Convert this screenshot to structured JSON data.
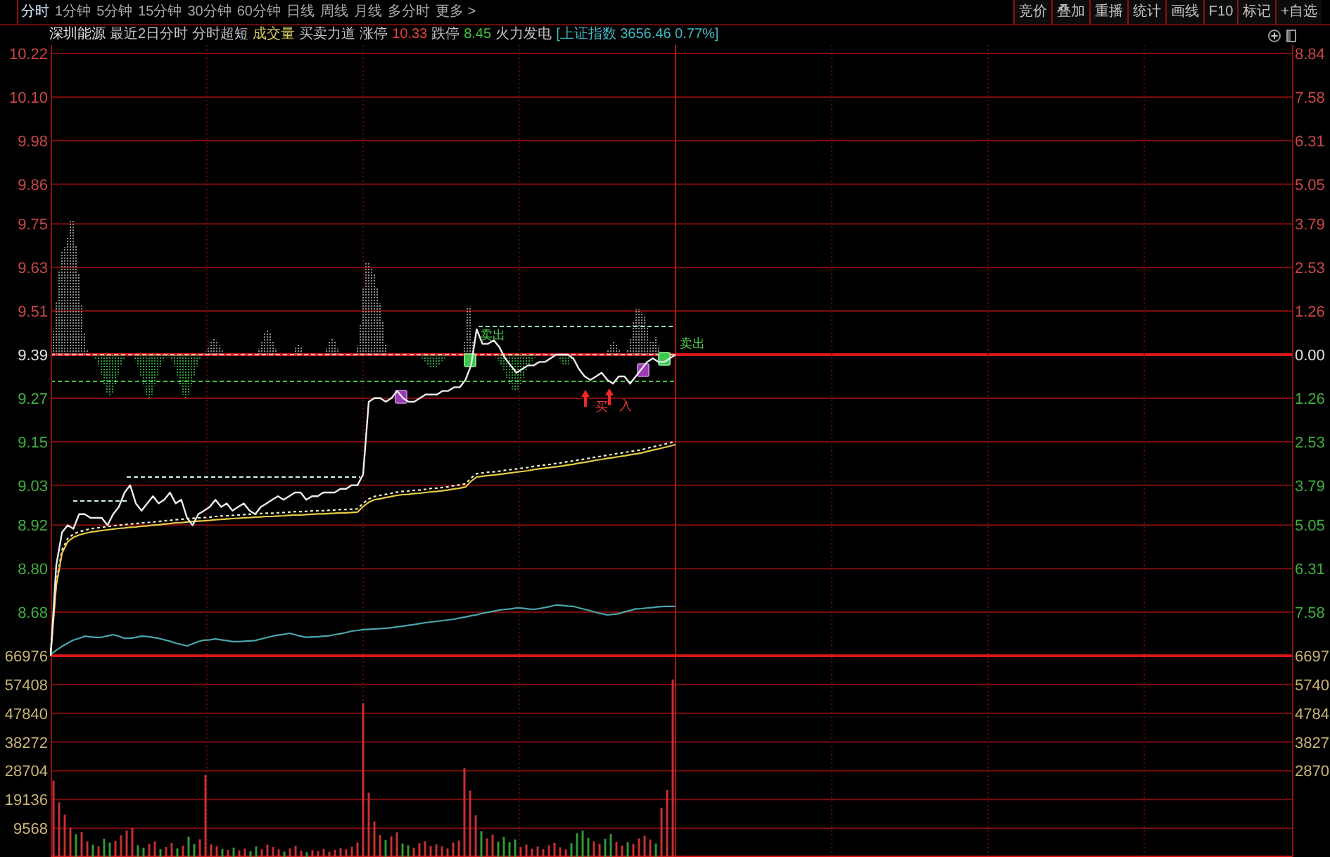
{
  "toolbar": {
    "tabs": [
      {
        "label": "分时",
        "selected": true
      },
      {
        "label": "1分钟",
        "selected": false
      },
      {
        "label": "5分钟",
        "selected": false
      },
      {
        "label": "15分钟",
        "selected": false
      },
      {
        "label": "30分钟",
        "selected": false
      },
      {
        "label": "60分钟",
        "selected": false
      },
      {
        "label": "日线",
        "selected": false
      },
      {
        "label": "周线",
        "selected": false
      },
      {
        "label": "月线",
        "selected": false
      },
      {
        "label": "多分时",
        "selected": false
      },
      {
        "label": "更多 >",
        "selected": false
      }
    ],
    "buttons": [
      "竞价",
      "叠加",
      "重播",
      "统计",
      "画线",
      "F10",
      "标记",
      "+自选"
    ]
  },
  "info_bar": [
    {
      "kind": "name",
      "text": "深圳能源"
    },
    {
      "kind": "option",
      "text": "最近2日分时"
    },
    {
      "kind": "option",
      "text": "分时超短"
    },
    {
      "kind": "volume",
      "text": "成交量"
    },
    {
      "kind": "option",
      "text": "买卖力道"
    },
    {
      "kind": "option",
      "text": "涨停"
    },
    {
      "kind": "up",
      "text": "10.33"
    },
    {
      "kind": "option",
      "text": "跌停"
    },
    {
      "kind": "down",
      "text": "8.45"
    },
    {
      "kind": "option",
      "text": "火力发电"
    },
    {
      "kind": "index",
      "text": "[上证指数 3656.46 0.77%]"
    }
  ],
  "chart": {
    "chart_data": {
      "type": "line",
      "ylim": [
        8.56,
        10.22
      ],
      "categories": [
        null,
        null,
        null,
        null,
        null,
        null,
        null,
        null,
        null,
        null,
        null,
        null,
        null,
        null,
        null,
        null,
        null,
        null,
        null,
        null,
        null,
        null,
        null,
        null,
        null,
        null,
        null,
        null,
        null,
        null,
        null,
        null,
        null,
        null,
        null,
        null,
        null,
        null,
        null,
        null,
        null,
        null,
        null,
        null,
        null,
        null,
        null,
        null,
        null,
        null,
        null,
        null,
        null,
        null,
        null,
        null,
        null,
        null,
        null,
        null,
        null,
        null,
        null,
        null,
        null,
        null,
        null,
        null,
        null,
        null,
        null,
        null,
        null,
        null,
        null,
        null,
        null,
        null,
        null,
        null,
        null,
        null,
        null,
        null,
        null,
        null,
        null,
        null,
        null,
        null,
        null,
        null,
        null,
        null,
        null,
        null,
        null,
        null,
        null,
        null,
        null,
        null,
        null,
        null,
        null,
        null,
        null,
        null,
        null,
        null,
        null
      ],
      "yticks": [
        {
          "value": 10.22,
          "label": "10.22"
        },
        {
          "value": 10.1,
          "label": "10.10"
        },
        {
          "value": 9.98,
          "label": "9.98"
        },
        {
          "value": 9.86,
          "label": "9.86"
        },
        {
          "value": 9.75,
          "label": "9.75"
        },
        {
          "value": 9.63,
          "label": "9.63"
        },
        {
          "value": 9.51,
          "label": "9.51"
        },
        {
          "value": 9.39,
          "label": "9.39"
        },
        {
          "value": 9.27,
          "label": "9.27"
        },
        {
          "value": 9.15,
          "label": "9.15"
        },
        {
          "value": 9.03,
          "label": "9.03"
        },
        {
          "value": 8.92,
          "label": "8.92"
        },
        {
          "value": 8.8,
          "label": "8.80"
        },
        {
          "value": 8.68,
          "label": "8.68"
        }
      ],
      "series": [
        {
          "color": "#ececec",
          "values": [
            8.56,
            8.81,
            8.9,
            8.92,
            8.91,
            8.95,
            8.95,
            8.94,
            8.94,
            8.94,
            8.92,
            8.95,
            8.97,
            9.01,
            9.03,
            8.98,
            8.96,
            8.98,
            9.0,
            8.98,
            8.99,
            9.01,
            8.98,
            8.99,
            8.94,
            8.92,
            8.95,
            8.96,
            8.97,
            8.99,
            8.97,
            8.98,
            8.96,
            8.97,
            8.98,
            8.96,
            8.95,
            8.97,
            8.98,
            8.99,
            9.0,
            8.99,
            9.0,
            9.01,
            9.01,
            8.99,
            9.0,
            9.0,
            9.01,
            9.01,
            9.01,
            9.02,
            9.02,
            9.03,
            9.03,
            9.06,
            9.26,
            9.27,
            9.27,
            9.26,
            9.27,
            9.29,
            9.27,
            9.26,
            9.26,
            9.27,
            9.28,
            9.28,
            9.28,
            9.29,
            9.29,
            9.3,
            9.3,
            9.32,
            9.36,
            9.46,
            9.42,
            9.42,
            9.43,
            9.41,
            9.38,
            9.36,
            9.34,
            9.35,
            9.36,
            9.36,
            9.37,
            9.37,
            9.38,
            9.39,
            9.39,
            9.39,
            9.38,
            9.35,
            9.33,
            9.32,
            9.33,
            9.34,
            9.32,
            9.31,
            9.33,
            9.33,
            9.31,
            9.33,
            9.35,
            9.37,
            9.38,
            9.37,
            9.37,
            9.38,
            9.39
          ]
        },
        {
          "color": "#e6cc44",
          "values": [
            8.564,
            8.754,
            8.843,
            8.874,
            8.886,
            8.893,
            8.897,
            8.901,
            8.903,
            8.905,
            8.907,
            8.909,
            8.911,
            8.912,
            8.914,
            8.915,
            8.917,
            8.918,
            8.92,
            8.921,
            8.923,
            8.924,
            8.926,
            8.927,
            8.929,
            8.93,
            8.931,
            8.932,
            8.933,
            8.935,
            8.936,
            8.937,
            8.938,
            8.939,
            8.94,
            8.941,
            8.942,
            8.943,
            8.944,
            8.944,
            8.945,
            8.946,
            8.947,
            8.948,
            8.948,
            8.949,
            8.95,
            8.951,
            8.951,
            8.952,
            8.953,
            8.954,
            8.954,
            8.955,
            8.956,
            8.971,
            8.983,
            8.99,
            8.993,
            8.996,
            8.999,
            9.002,
            9.004,
            9.005,
            9.007,
            9.008,
            9.01,
            9.012,
            9.013,
            9.015,
            9.017,
            9.02,
            9.022,
            9.025,
            9.041,
            9.053,
            9.055,
            9.057,
            9.058,
            9.06,
            9.062,
            9.064,
            9.066,
            9.068,
            9.07,
            9.073,
            9.075,
            9.077,
            9.079,
            9.081,
            9.083,
            9.086,
            9.088,
            9.091,
            9.093,
            9.096,
            9.099,
            9.101,
            9.104,
            9.106,
            9.109,
            9.111,
            9.114,
            9.116,
            9.119,
            9.123,
            9.127,
            9.13,
            9.134,
            9.138,
            9.142
          ]
        },
        {
          "color": "#f2f0c8",
          "line_style": "dashed",
          "values": [
            8.573,
            8.763,
            8.852,
            8.883,
            8.895,
            8.902,
            8.906,
            8.91,
            8.912,
            8.914,
            8.916,
            8.918,
            8.92,
            8.921,
            8.923,
            8.924,
            8.926,
            8.927,
            8.929,
            8.93,
            8.932,
            8.933,
            8.935,
            8.936,
            8.938,
            8.939,
            8.94,
            8.941,
            8.942,
            8.944,
            8.945,
            8.946,
            8.947,
            8.948,
            8.949,
            8.95,
            8.951,
            8.952,
            8.953,
            8.953,
            8.954,
            8.955,
            8.956,
            8.957,
            8.957,
            8.958,
            8.959,
            8.96,
            8.96,
            8.961,
            8.962,
            8.963,
            8.963,
            8.964,
            8.965,
            8.98,
            8.992,
            8.999,
            9.002,
            9.005,
            9.008,
            9.011,
            9.013,
            9.014,
            9.016,
            9.017,
            9.019,
            9.021,
            9.022,
            9.024,
            9.026,
            9.029,
            9.031,
            9.034,
            9.05,
            9.062,
            9.064,
            9.066,
            9.067,
            9.069,
            9.071,
            9.073,
            9.075,
            9.077,
            9.079,
            9.082,
            9.084,
            9.086,
            9.088,
            9.09,
            9.092,
            9.095,
            9.097,
            9.1,
            9.102,
            9.105,
            9.108,
            9.11,
            9.113,
            9.115,
            9.118,
            9.12,
            9.123,
            9.125,
            9.128,
            9.132,
            9.136,
            9.139,
            9.143,
            9.147,
            9.151
          ]
        },
        {
          "color": "#4aa6ac",
          "values": [
            8.564,
            8.575,
            8.586,
            8.595,
            8.603,
            8.608,
            8.614,
            8.612,
            8.611,
            8.611,
            8.615,
            8.618,
            8.614,
            8.608,
            8.608,
            8.611,
            8.614,
            8.613,
            8.611,
            8.608,
            8.604,
            8.6,
            8.595,
            8.591,
            8.587,
            8.593,
            8.599,
            8.603,
            8.604,
            8.606,
            8.604,
            8.602,
            8.599,
            8.599,
            8.6,
            8.601,
            8.602,
            8.606,
            8.61,
            8.614,
            8.617,
            8.619,
            8.622,
            8.618,
            8.614,
            8.611,
            8.612,
            8.612,
            8.614,
            8.615,
            8.618,
            8.621,
            8.624,
            8.628,
            8.63,
            8.632,
            8.633,
            8.634,
            8.635,
            8.636,
            8.637,
            8.64,
            8.642,
            8.644,
            8.646,
            8.649,
            8.651,
            8.653,
            8.655,
            8.657,
            8.659,
            8.661,
            8.664,
            8.667,
            8.67,
            8.673,
            8.677,
            8.68,
            8.683,
            8.686,
            8.688,
            8.689,
            8.692,
            8.691,
            8.689,
            8.688,
            8.69,
            8.693,
            8.696,
            8.7,
            8.699,
            8.697,
            8.696,
            8.692,
            8.688,
            8.684,
            8.68,
            8.676,
            8.673,
            8.674,
            8.676,
            8.681,
            8.685,
            8.689,
            8.69,
            8.692,
            8.693,
            8.695,
            8.696,
            8.696,
            8.696
          ]
        }
      ]
    },
    "signals": [
      {
        "kind": "sell",
        "text": "卖出"
      },
      {
        "kind": "sell",
        "text": "卖出"
      },
      {
        "kind": "mark"
      },
      {
        "kind": "mark"
      },
      {
        "kind": "buy",
        "text": "买"
      },
      {
        "kind": "buy",
        "text": "入"
      }
    ],
    "percent_axis": [
      {
        "text": "8.84",
        "kind": "up"
      },
      {
        "text": "7.58",
        "kind": "up"
      },
      {
        "text": "6.31",
        "kind": "up"
      },
      {
        "text": "5.05",
        "kind": "up"
      },
      {
        "text": "3.79",
        "kind": "up"
      },
      {
        "text": "2.53",
        "kind": "up"
      },
      {
        "text": "1.26",
        "kind": "up"
      },
      {
        "text": "0.00",
        "kind": "flat"
      },
      {
        "text": "1.26",
        "kind": "down"
      },
      {
        "text": "2.53",
        "kind": "down"
      },
      {
        "text": "3.79",
        "kind": "down"
      },
      {
        "text": "5.05",
        "kind": "down"
      },
      {
        "text": "6.31",
        "kind": "down"
      },
      {
        "text": "7.58",
        "kind": "down"
      }
    ]
  },
  "volume": {
    "chart_data": {
      "type": "bar",
      "ylim": [
        0,
        66976
      ],
      "grid": true,
      "categories": [
        null,
        null,
        null,
        null,
        null,
        null,
        null,
        null,
        null,
        null,
        null,
        null,
        null,
        null,
        null,
        null,
        null,
        null,
        null,
        null,
        null,
        null,
        null,
        null,
        null,
        null,
        null,
        null,
        null,
        null,
        null,
        null,
        null,
        null,
        null,
        null,
        null,
        null,
        null,
        null,
        null,
        null,
        null,
        null,
        null,
        null,
        null,
        null,
        null,
        null,
        null,
        null,
        null,
        null,
        null,
        null,
        null,
        null,
        null,
        null,
        null,
        null,
        null,
        null,
        null,
        null,
        null,
        null,
        null,
        null,
        null,
        null,
        null,
        null,
        null,
        null,
        null,
        null,
        null,
        null,
        null,
        null,
        null,
        null,
        null,
        null,
        null,
        null,
        null,
        null,
        null,
        null,
        null,
        null,
        null,
        null,
        null,
        null,
        null,
        null,
        null,
        null,
        null,
        null,
        null,
        null,
        null,
        null,
        null,
        null,
        null
      ],
      "yticks": [
        {
          "value": 66976,
          "label": "66976"
        },
        {
          "value": 57408,
          "label": "57408"
        },
        {
          "value": 47840,
          "label": "47840"
        },
        {
          "value": 38272,
          "label": "38272"
        },
        {
          "value": 28704,
          "label": "28704"
        },
        {
          "value": 19136,
          "label": "19136"
        },
        {
          "value": 9568,
          "label": "9568"
        }
      ],
      "series": [
        {
          "color": "#c83030",
          "values": [
            25400,
            18200,
            14100,
            9800,
            null,
            8300,
            5200,
            null,
            3600,
            null,
            null,
            5400,
            7200,
            8800,
            9600,
            null,
            null,
            4400,
            5200,
            null,
            3300,
            4700,
            null,
            3800,
            null,
            null,
            5900,
            27300,
            4200,
            3600,
            null,
            2400,
            null,
            2200,
            2800,
            null,
            null,
            2600,
            4100,
            3300,
            2500,
            null,
            2900,
            3700,
            2100,
            null,
            2300,
            2000,
            2700,
            1700,
            2400,
            3000,
            2600,
            3400,
            4800,
            51200,
            21400,
            11800,
            7300,
            null,
            6900,
            8200,
            null,
            null,
            3100,
            4600,
            5300,
            3700,
            4200,
            3600,
            2900,
            4800,
            5500,
            29600,
            22100,
            13900,
            null,
            6200,
            7400,
            null,
            null,
            null,
            null,
            3300,
            4100,
            2800,
            3500,
            2600,
            3900,
            4700,
            3200,
            2500,
            null,
            null,
            null,
            null,
            5200,
            4400,
            null,
            null,
            5000,
            3800,
            null,
            4300,
            6200,
            7100,
            5800,
            null,
            16400,
            22300,
            59100
          ]
        },
        {
          "color": "#2e9a38",
          "values": [
            null,
            null,
            null,
            null,
            7600,
            null,
            null,
            4100,
            null,
            6100,
            4800,
            null,
            null,
            null,
            null,
            3900,
            3100,
            null,
            null,
            2600,
            null,
            null,
            2900,
            null,
            6800,
            4300,
            null,
            null,
            null,
            null,
            2700,
            null,
            3100,
            null,
            null,
            1900,
            3500,
            null,
            null,
            null,
            null,
            1800,
            null,
            null,
            null,
            1600,
            null,
            null,
            null,
            null,
            null,
            null,
            null,
            null,
            null,
            null,
            null,
            null,
            null,
            5600,
            null,
            null,
            4500,
            3900,
            null,
            null,
            null,
            null,
            null,
            null,
            null,
            null,
            null,
            null,
            null,
            null,
            8600,
            null,
            null,
            5100,
            6700,
            4900,
            5800,
            null,
            null,
            null,
            null,
            null,
            null,
            null,
            null,
            null,
            4600,
            7900,
            8800,
            6400,
            null,
            null,
            6100,
            7700,
            null,
            null,
            4900,
            null,
            null,
            null,
            null,
            4500,
            null,
            null,
            null
          ]
        }
      ]
    },
    "right_axis": [
      "6697",
      "5740",
      "4784",
      "3827",
      "2870"
    ]
  }
}
